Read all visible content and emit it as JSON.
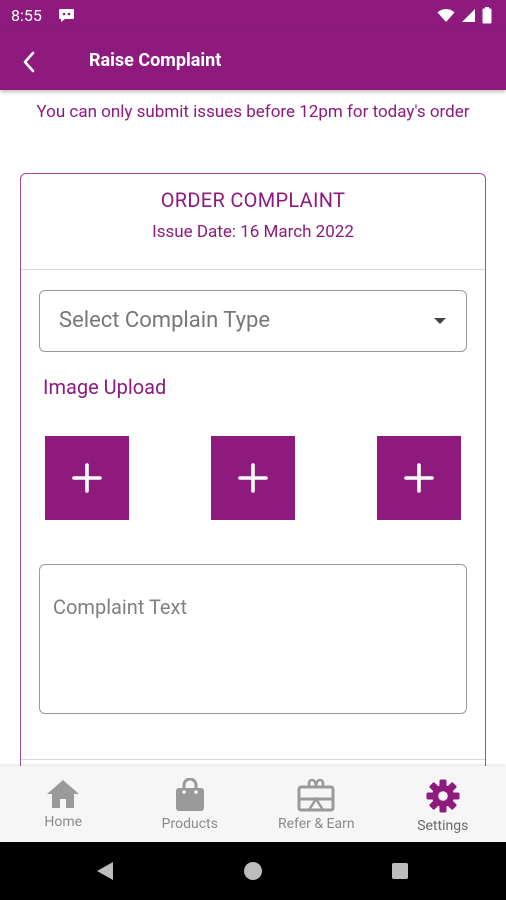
{
  "status_bar": {
    "time": "8:55"
  },
  "app_bar": {
    "title": "Raise Complaint"
  },
  "notice": "You can only submit issues before 12pm for today's order",
  "card": {
    "title": "ORDER COMPLAINT",
    "issue_date": "Issue Date: 16 March 2022",
    "complain_type_placeholder": "Select Complain Type",
    "image_upload_label": "Image Upload",
    "upload_slots": 3,
    "complaint_text_placeholder": "Complaint Text"
  },
  "bottom_nav": {
    "items": [
      {
        "label": "Home",
        "icon": "home-icon"
      },
      {
        "label": "Products",
        "icon": "shopping-bag-icon"
      },
      {
        "label": "Refer & Earn",
        "icon": "gift-card-icon"
      },
      {
        "label": "Settings",
        "icon": "gear-icon",
        "active": true
      }
    ]
  },
  "colors": {
    "primary": "#8e1a7d",
    "nav_bg": "#f6f6f6",
    "inactive": "#8a8a8a"
  }
}
